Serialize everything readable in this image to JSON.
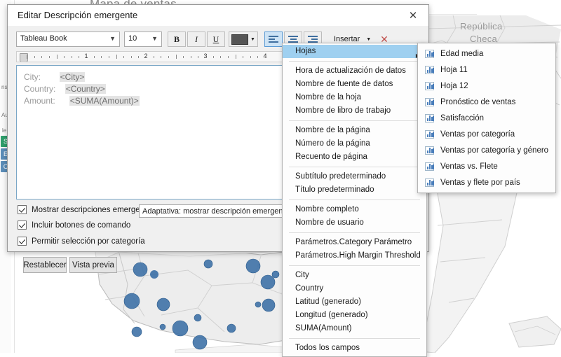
{
  "worksheet": {
    "title": "Mapa de ventas",
    "map_label": "República Checa",
    "rail": {
      "item_top": "le",
      "chips": [
        {
          "letter": "S",
          "color": "#2e9e6b"
        },
        {
          "letter": "E",
          "color": "#5b8db8"
        },
        {
          "letter": "C",
          "color": "#5b8db8"
        }
      ],
      "top_text": "ns",
      "second_text": "Au"
    }
  },
  "dialog": {
    "title": "Editar Descripción emergente",
    "close_icon": "close-icon",
    "toolbar": {
      "font_family": "Tableau Book",
      "font_size": "10",
      "bold_label": "B",
      "italic_label": "I",
      "underline_label": "U",
      "color_label": "color-swatch",
      "align_left_label": "align-left-icon",
      "align_center_label": "align-center-icon",
      "align_right_label": "align-right-icon",
      "insert_label": "Insertar",
      "delete_label": "✕",
      "color_hex": "#555555",
      "active_align": "left"
    },
    "ruler": {
      "numbers": [
        "1",
        "2",
        "3",
        "4"
      ]
    },
    "content": {
      "rows": [
        {
          "label": "City:",
          "pad": 4,
          "field": "<City>"
        },
        {
          "label": "Country:",
          "pad": 2,
          "field": "<Country>"
        },
        {
          "label": "Amount:",
          "pad": 3,
          "field": "<SUMA(Amount)>"
        }
      ]
    },
    "options": {
      "show_tooltips": "Mostrar descripciones emergentes",
      "include_command_buttons": "Incluir botones de comando",
      "allow_category_selection": "Permitir selección por categoría",
      "show_tooltips_checked": true,
      "include_command_buttons_checked": true,
      "allow_category_selection_checked": true,
      "mode_value": "Adaptativa: mostrar descripción emergente de for"
    },
    "buttons": {
      "reset": "Restablecer",
      "preview": "Vista previa"
    }
  },
  "insert_menu": {
    "groups": [
      [
        {
          "label": "Hojas",
          "submenu": true,
          "selected": true,
          "arrow": "▶"
        }
      ],
      [
        {
          "label": "Hora de actualización de datos"
        },
        {
          "label": "Nombre de fuente de datos"
        },
        {
          "label": "Nombre de la hoja"
        },
        {
          "label": "Nombre de libro de trabajo"
        }
      ],
      [
        {
          "label": "Nombre de la página"
        },
        {
          "label": "Número de la página"
        },
        {
          "label": "Recuento de página"
        }
      ],
      [
        {
          "label": "Subtítulo predeterminado"
        },
        {
          "label": "Título predeterminado"
        }
      ],
      [
        {
          "label": "Nombre completo"
        },
        {
          "label": "Nombre de usuario"
        }
      ],
      [
        {
          "label": "Parámetros.Category Parámetro"
        },
        {
          "label": "Parámetros.High Margin Threshold"
        }
      ],
      [
        {
          "label": "City"
        },
        {
          "label": "Country"
        },
        {
          "label": "Latitud (generado)"
        },
        {
          "label": "Longitud (generado)"
        },
        {
          "label": "SUMA(Amount)"
        }
      ],
      [
        {
          "label": "Todos los campos"
        }
      ]
    ]
  },
  "sheets_submenu": {
    "items": [
      {
        "label": "Edad media",
        "icon": "bar-chart-icon"
      },
      {
        "label": "Hoja 11",
        "icon": "bar-chart-icon"
      },
      {
        "label": "Hoja 12",
        "icon": "bar-chart-icon"
      },
      {
        "label": "Pronóstico de ventas",
        "icon": "bar-chart-icon"
      },
      {
        "label": "Satisfacción",
        "icon": "bar-chart-icon"
      },
      {
        "label": "Ventas por categoría",
        "icon": "bar-chart-icon"
      },
      {
        "label": "Ventas por categoría y género",
        "icon": "bar-chart-icon"
      },
      {
        "label": "Ventas vs. Flete",
        "icon": "bar-chart-icon"
      },
      {
        "label": "Ventas y flete por país",
        "icon": "bar-chart-icon"
      }
    ]
  },
  "colors": {
    "accent": "#5b9bd5",
    "menu_highlight": "#9fd0f0",
    "map_marker": "#3a6ea5"
  }
}
